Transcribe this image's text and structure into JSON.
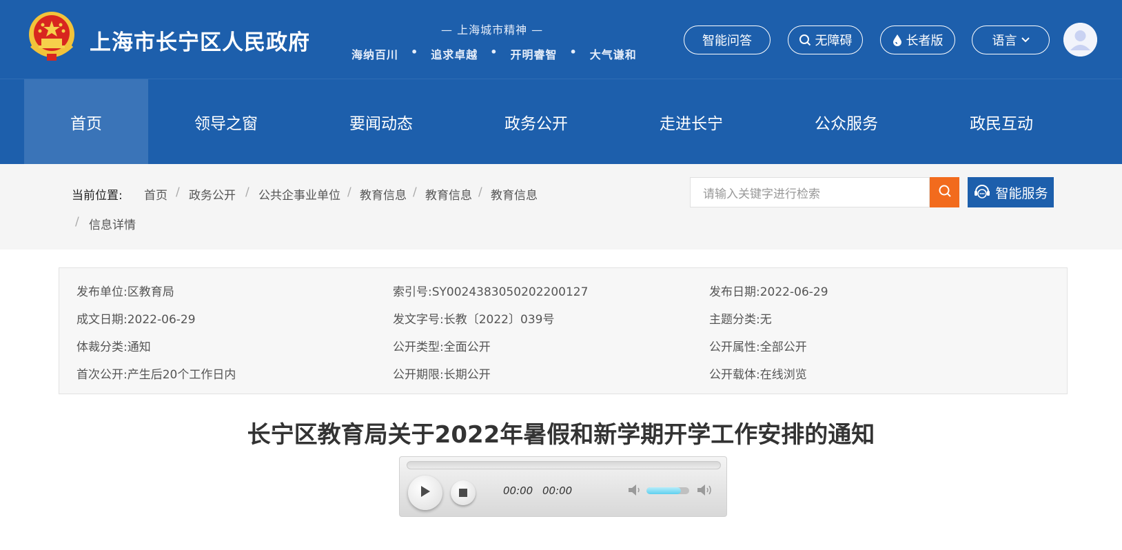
{
  "header": {
    "site_title": "上海市长宁区人民政府",
    "spirit_title": "— 上海城市精神 —",
    "spirit_words": [
      "海纳百川",
      "追求卓越",
      "开明睿智",
      "大气谦和"
    ],
    "spirit_dot": "•",
    "btn_qa": "智能问答",
    "btn_access": "无障碍",
    "btn_elder": "长者版",
    "btn_lang": "语言"
  },
  "nav": {
    "items": [
      "首页",
      "领导之窗",
      "要闻动态",
      "政务公开",
      "走进长宁",
      "公众服务",
      "政民互动"
    ],
    "active_index": 0
  },
  "breadcrumb": {
    "label": "当前位置:",
    "items": [
      "首页",
      "政务公开",
      "公共企事业单位",
      "教育信息",
      "教育信息",
      "教育信息",
      "信息详情"
    ],
    "separator": "/"
  },
  "search": {
    "placeholder": "请输入关键字进行检索",
    "smart_service": "智能服务"
  },
  "meta": {
    "rows": [
      [
        {
          "k": "发布单位:",
          "v": "区教育局"
        },
        {
          "k": "索引号:",
          "v": "SY0024383050202200127"
        },
        {
          "k": "发布日期:",
          "v": "2022-06-29"
        }
      ],
      [
        {
          "k": "成文日期:",
          "v": "2022-06-29"
        },
        {
          "k": "发文字号:",
          "v": "长教〔2022〕039号"
        },
        {
          "k": "主题分类:",
          "v": "无"
        }
      ],
      [
        {
          "k": "体裁分类:",
          "v": "通知"
        },
        {
          "k": "公开类型:",
          "v": "全面公开"
        },
        {
          "k": "公开属性:",
          "v": "全部公开"
        }
      ],
      [
        {
          "k": "首次公开:",
          "v": "产生后20个工作日内"
        },
        {
          "k": "公开期限:",
          "v": "长期公开"
        },
        {
          "k": "公开载体:",
          "v": "在线浏览"
        }
      ]
    ]
  },
  "document": {
    "title": "长宁区教育局关于2022年暑假和新学期开学工作安排的通知"
  },
  "player": {
    "current_time": "00:00",
    "duration": "00:00",
    "progress": 0,
    "volume": 0.8
  },
  "colors": {
    "header_bg": "#1d5fac",
    "search_accent": "#f26b1d"
  }
}
